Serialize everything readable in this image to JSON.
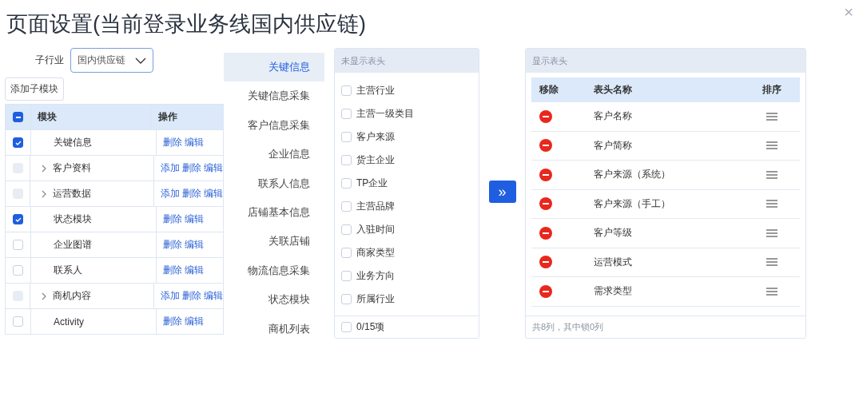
{
  "dialog": {
    "title": "页面设置(当前登录业务线国内供应链)",
    "close": "×"
  },
  "sub_industry": {
    "label": "子行业",
    "value": "国内供应链"
  },
  "add_button": "添加子模块",
  "module_table": {
    "header_checkbox": {
      "indeterminate": true
    },
    "columns": [
      "模块",
      "操作"
    ],
    "rows": [
      {
        "name": "关键信息",
        "checked": true,
        "disabled": false,
        "has_children": false,
        "actions": [
          "删除",
          "编辑"
        ]
      },
      {
        "name": "客户资料",
        "checked": false,
        "disabled": true,
        "has_children": true,
        "actions": [
          "添加",
          "删除",
          "编辑"
        ]
      },
      {
        "name": "运营数据",
        "checked": false,
        "disabled": true,
        "has_children": true,
        "actions": [
          "添加",
          "删除",
          "编辑"
        ]
      },
      {
        "name": "状态模块",
        "checked": true,
        "disabled": false,
        "has_children": false,
        "actions": [
          "删除",
          "编辑"
        ]
      },
      {
        "name": "企业图谱",
        "checked": false,
        "disabled": false,
        "has_children": false,
        "actions": [
          "删除",
          "编辑"
        ]
      },
      {
        "name": "联系人",
        "checked": false,
        "disabled": false,
        "has_children": false,
        "actions": [
          "删除",
          "编辑"
        ]
      },
      {
        "name": "商机内容",
        "checked": false,
        "disabled": true,
        "has_children": true,
        "actions": [
          "添加",
          "删除",
          "编辑"
        ]
      },
      {
        "name": "Activity",
        "checked": false,
        "disabled": false,
        "has_children": false,
        "actions": [
          "删除",
          "编辑"
        ]
      }
    ]
  },
  "section_tabs": [
    {
      "label": "关键信息",
      "selected": true
    },
    {
      "label": "关键信息采集",
      "selected": false
    },
    {
      "label": "客户信息采集",
      "selected": false
    },
    {
      "label": "企业信息",
      "selected": false
    },
    {
      "label": "联系人信息",
      "selected": false
    },
    {
      "label": "店铺基本信息",
      "selected": false
    },
    {
      "label": "关联店铺",
      "selected": false
    },
    {
      "label": "物流信息采集",
      "selected": false
    },
    {
      "label": "状态模块",
      "selected": false
    },
    {
      "label": "商机列表",
      "selected": false
    }
  ],
  "hidden_columns": {
    "title": "未显示表头",
    "footer": "0/15项",
    "footer_checked": false,
    "items": [
      {
        "label": "主营行业",
        "checked": false
      },
      {
        "label": "主营一级类目",
        "checked": false
      },
      {
        "label": "客户来源",
        "checked": false
      },
      {
        "label": "货主企业",
        "checked": false
      },
      {
        "label": "TP企业",
        "checked": false
      },
      {
        "label": "主营品牌",
        "checked": false
      },
      {
        "label": "入驻时间",
        "checked": false
      },
      {
        "label": "商家类型",
        "checked": false
      },
      {
        "label": "业务方向",
        "checked": false
      },
      {
        "label": "所属行业",
        "checked": false
      }
    ]
  },
  "move_button": "»",
  "shown_columns": {
    "title": "显示表头",
    "columns": [
      "移除",
      "表头名称",
      "排序"
    ],
    "rows": [
      "客户名称",
      "客户简称",
      "客户来源（系统）",
      "客户来源（手工）",
      "客户等级",
      "运营模式",
      "需求类型"
    ],
    "footer": "共8列，其中锁0列"
  }
}
